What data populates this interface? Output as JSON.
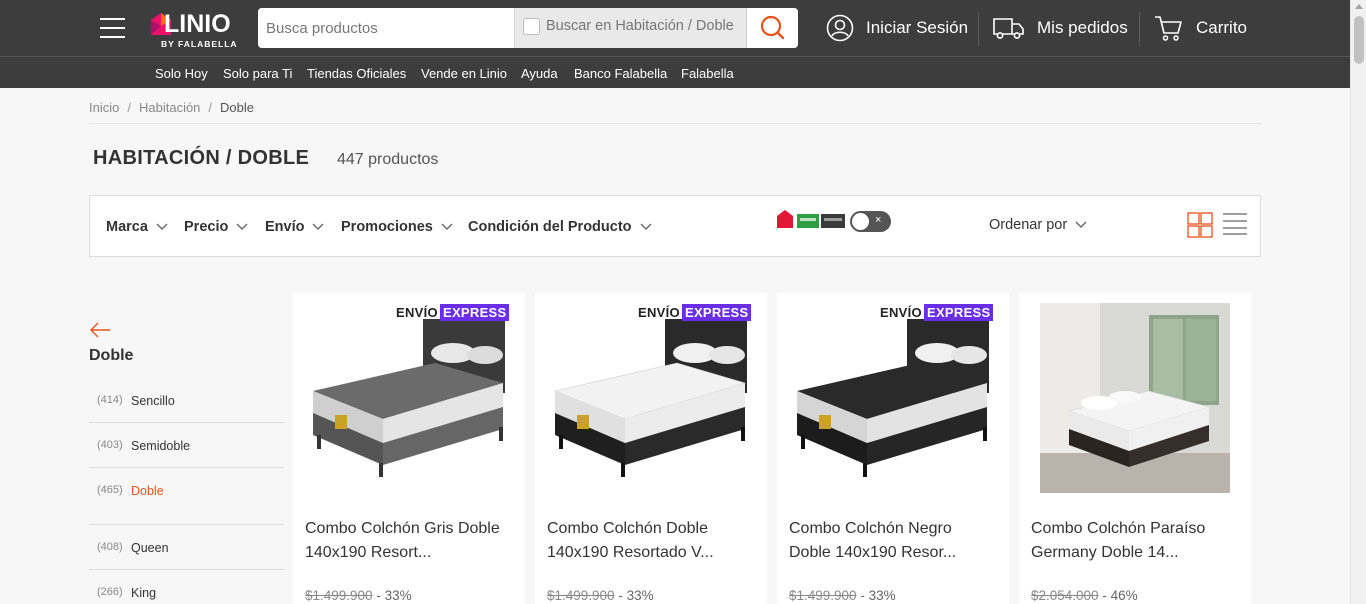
{
  "header": {
    "brand": "LINIO",
    "brand_sub": "BY FALABELLA",
    "search_placeholder": "Busca productos",
    "scope_label": "Buscar en Habitación / Doble",
    "login": "Iniciar Sesión",
    "orders": "Mis pedidos",
    "cart": "Carrito"
  },
  "subnav": [
    "Solo Hoy",
    "Solo para Ti",
    "Tiendas Oficiales",
    "Vende en Linio",
    "Ayuda",
    "Banco Falabella",
    "Falabella"
  ],
  "breadcrumb": {
    "items": [
      "Inicio",
      "Habitación"
    ],
    "current": "Doble",
    "separator": "/"
  },
  "page": {
    "title": "HABITACIÓN / DOBLE",
    "count": "447 productos"
  },
  "filters": {
    "items": [
      "Marca",
      "Precio",
      "Envío",
      "Promociones",
      "Condición del Producto"
    ],
    "toggle_x": "×",
    "sort": "Ordenar por"
  },
  "sidebar": {
    "title": "Doble",
    "categories": [
      {
        "count": "(414)",
        "name": "Sencillo"
      },
      {
        "count": "(403)",
        "name": "Semidoble"
      },
      {
        "count": "(465)",
        "name": "Doble"
      },
      {
        "count": "(408)",
        "name": "Queen"
      },
      {
        "count": "(266)",
        "name": "King"
      }
    ]
  },
  "products": [
    {
      "title": "Combo Colchón Gris Doble 140x190 Resort...",
      "old_price": "$1.499.900",
      "discount": " - 33%",
      "express": true,
      "mattress_color": "#6b6b6b",
      "base_color": "#555555"
    },
    {
      "title": "Combo Colchón Doble 140x190 Resortado V...",
      "old_price": "$1.499.900",
      "discount": " - 33%",
      "express": true,
      "mattress_color": "#f2f2f2",
      "base_color": "#1f1f1f"
    },
    {
      "title": "Combo Colchón Negro Doble 140x190 Resor...",
      "old_price": "$1.499.900",
      "discount": " - 33%",
      "express": true,
      "mattress_color": "#2a2a2a",
      "base_color": "#1c1c1c"
    },
    {
      "title": "Combo Colchón Paraíso Germany Doble 14...",
      "old_price": "$2.054.000",
      "discount": " - 46%",
      "express": false,
      "mattress_color": "#f4f4f4",
      "base_color": "#2b2522"
    }
  ],
  "express_label": {
    "part1": "ENVÍO",
    "part2": "EXPRESS"
  },
  "colors": {
    "header_bg": "#3d3d3d",
    "accent": "#e9511b",
    "express_purple": "#6a2ee8"
  }
}
